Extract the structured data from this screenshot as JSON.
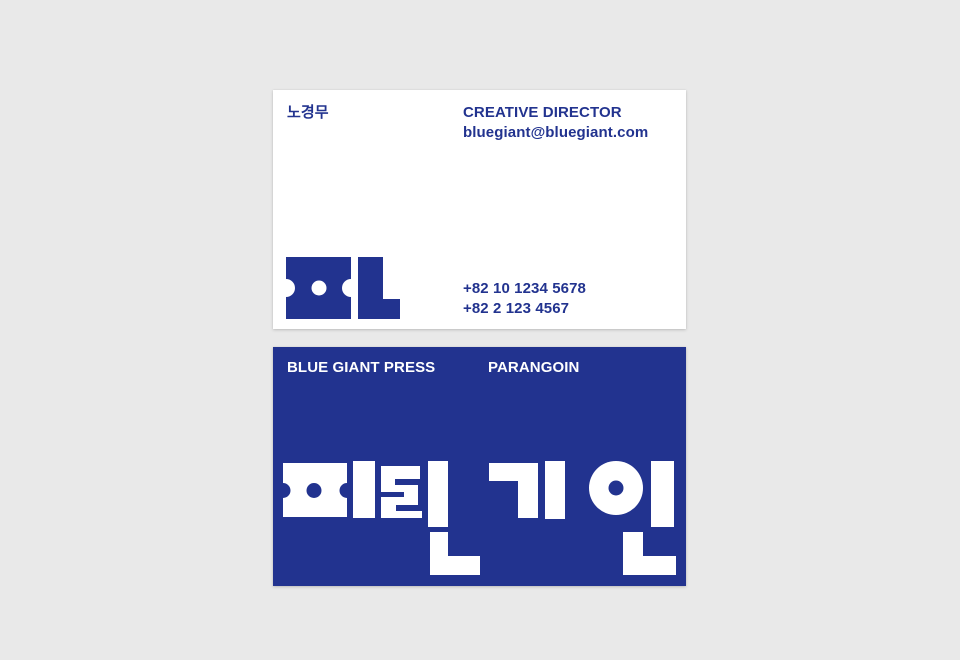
{
  "front_card": {
    "name": "노경무",
    "title": "CREATIVE DIRECTOR",
    "email": "bluegiant@bluegiant.com",
    "phone_mobile": "+82 10 1234 5678",
    "phone_office": "+82 2 123 4567",
    "logo_icon": "pa-glyph-logo-icon"
  },
  "back_card": {
    "company": "BLUE GIANT PRESS",
    "product": "PARANGOIN",
    "wordmark_icon": "paranggoin-wordmark-icon"
  },
  "colors": {
    "brand_blue": "#22338f",
    "card_white": "#ffffff",
    "background": "#e9e9e9"
  }
}
